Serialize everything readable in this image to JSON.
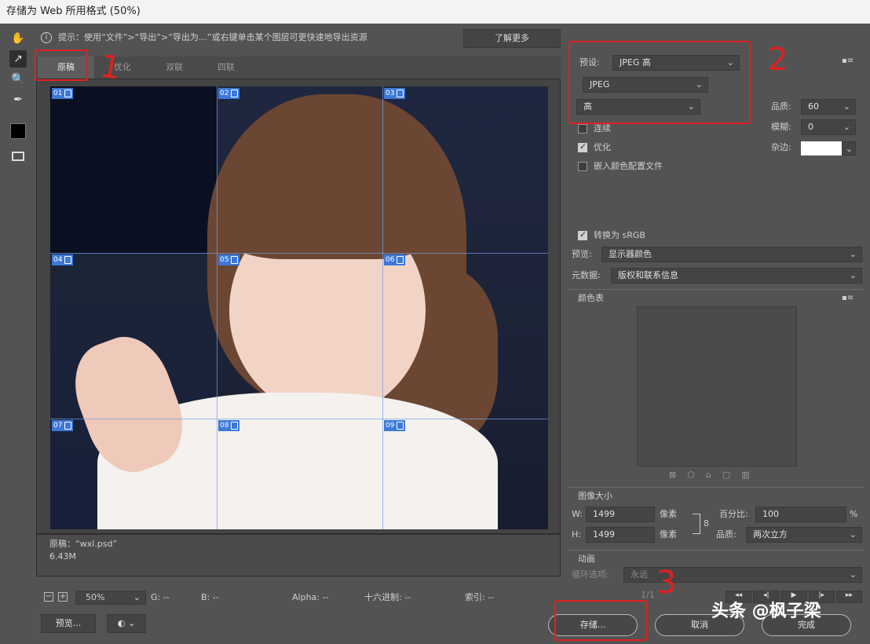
{
  "window": {
    "title": "存储为 Web 所用格式 (50%)"
  },
  "hint": {
    "text": "提示：使用“文件”>“导出”>“导出为…”或右键单击某个图层可更快速地导出资源",
    "learn_more": "了解更多"
  },
  "tabs": [
    "原稿",
    "优化",
    "双联",
    "四联"
  ],
  "slices": [
    "01",
    "02",
    "03",
    "04",
    "05",
    "06",
    "07",
    "08",
    "09"
  ],
  "image_info": {
    "name": "原稿：“wxl.psd”",
    "size": "6.43M"
  },
  "status": {
    "zoom": "50%",
    "g": "G: --",
    "b": "B: --",
    "alpha": "Alpha: --",
    "hex": "十六进制: --",
    "index": "索引: --"
  },
  "buttons": {
    "preview": "预览...",
    "save": "存储...",
    "cancel": "取消",
    "done": "完成"
  },
  "settings": {
    "preset_label": "预设:",
    "preset_value": "JPEG 高",
    "format_value": "JPEG",
    "quality_preset": "高",
    "quality_label": "品质:",
    "quality_value": "60",
    "blur_label": "模糊:",
    "blur_value": "0",
    "matte_label": "杂边:",
    "progressive": "连续",
    "optimized": "优化",
    "embed_profile": "嵌入颜色配置文件",
    "convert_srgb": "转换为 sRGB",
    "preview_label": "预览:",
    "preview_value": "显示器颜色",
    "metadata_label": "元数据:",
    "metadata_value": "版权和联系信息"
  },
  "color_table": {
    "title": "颜色表"
  },
  "image_size": {
    "title": "图像大小",
    "w_label": "W:",
    "w_value": "1499",
    "h_label": "H:",
    "h_value": "1499",
    "unit": "像素",
    "percent_label": "百分比:",
    "percent_value": "100",
    "percent_unit": "%",
    "quality_label": "品质:",
    "quality_value": "两次立方"
  },
  "animation": {
    "title": "动画",
    "loop_label": "循环选项:",
    "loop_value": "永远",
    "frame": "1/1"
  },
  "annotations": {
    "n1": "1",
    "n2": "2",
    "n3": "3"
  },
  "watermark": "头条 @枫子梁",
  "colors": {
    "annotation": "#e02020",
    "slice": "#3c78d8",
    "dialog_bg": "#535353"
  }
}
